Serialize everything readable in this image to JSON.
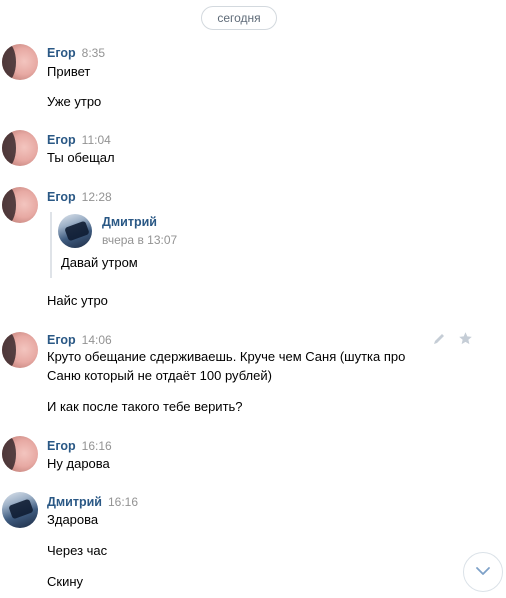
{
  "date_separator": "сегодня",
  "messages": [
    {
      "author": "Егор",
      "time": "8:35",
      "lines": [
        "Привет",
        "Уже утро"
      ]
    },
    {
      "author": "Егор",
      "time": "11:04",
      "lines": [
        "Ты обещал"
      ]
    },
    {
      "author": "Егор",
      "time": "12:28",
      "reply": {
        "author": "Дмитрий",
        "time": "вчера в 13:07",
        "text": "Давай утром"
      },
      "lines": [
        "Найс утро"
      ]
    },
    {
      "author": "Егор",
      "time": "14:06",
      "lines": [
        "Круто обещание сдерживаешь. Круче чем Саня (шутка про",
        "Саню который не отдаёт 100 рублей)",
        "И как после такого тебе верить?"
      ]
    },
    {
      "author": "Егор",
      "time": "16:16",
      "lines": [
        "Ну дарова"
      ]
    },
    {
      "author": "Дмитрий",
      "time": "16:16",
      "lines": [
        "Здарова",
        "Через час",
        "Скину"
      ]
    }
  ],
  "icons": {
    "edit": "pencil-icon",
    "favorite": "star-icon",
    "scroll_down": "chevron-down-icon"
  },
  "colors": {
    "author": "#2a5885",
    "time": "#939393",
    "accent_border": "#d3d9de"
  }
}
